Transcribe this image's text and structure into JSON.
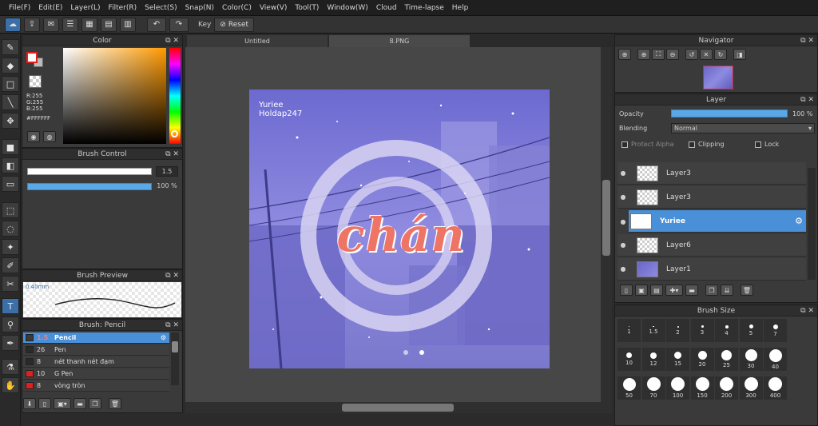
{
  "menu": [
    "File(F)",
    "Edit(E)",
    "Layer(L)",
    "Filter(R)",
    "Select(S)",
    "Snap(N)",
    "Color(C)",
    "View(V)",
    "Tool(T)",
    "Window(W)",
    "Cloud",
    "Time-lapse",
    "Help"
  ],
  "toolbar": {
    "key_label": "Key",
    "reset_label": "Reset"
  },
  "color_panel": {
    "title": "Color",
    "r": "R:255",
    "g": "G:255",
    "b": "B:255",
    "hex": "#FFFFFF"
  },
  "brush_control": {
    "title": "Brush Control",
    "size_value": "1.5",
    "opacity_value": "100 %"
  },
  "brush_preview": {
    "title": "Brush Preview",
    "size": "0.40mm"
  },
  "brush_list": {
    "title": "Brush: Pencil",
    "items": [
      {
        "size": "1.5",
        "name": "Pencil",
        "color": "#3a3a3a"
      },
      {
        "size": "26",
        "name": "Pen",
        "color": "#2a2a2a"
      },
      {
        "size": "8",
        "name": "nét thanh nét đạm",
        "color": "#2a2a2a"
      },
      {
        "size": "10",
        "name": "G Pen",
        "color": "#e02020"
      },
      {
        "size": "8",
        "name": "vòng tròn",
        "color": "#e02020"
      }
    ]
  },
  "tabs": [
    "Untitled",
    "8.PNG"
  ],
  "artwork": {
    "line1": "Yuriee",
    "line2": "Holdap247",
    "word": "chán"
  },
  "navigator": {
    "title": "Navigator"
  },
  "layer_panel": {
    "title": "Layer",
    "opacity_label": "Opacity",
    "opacity_value": "100 %",
    "blending_label": "Blending",
    "blending_value": "Normal",
    "protect_alpha": "Protect Alpha",
    "clipping": "Clipping",
    "lock": "Lock",
    "layers": [
      {
        "name": "Layer3"
      },
      {
        "name": "Layer3"
      },
      {
        "name": "Yuriee"
      },
      {
        "name": "Layer6"
      },
      {
        "name": "Layer1"
      }
    ]
  },
  "brush_size": {
    "title": "Brush Size",
    "sizes": [
      "1",
      "1.5",
      "2",
      "3",
      "4",
      "5",
      "7",
      "10",
      "12",
      "15",
      "20",
      "25",
      "30",
      "40",
      "50",
      "70",
      "100",
      "150",
      "200",
      "300",
      "400"
    ]
  }
}
